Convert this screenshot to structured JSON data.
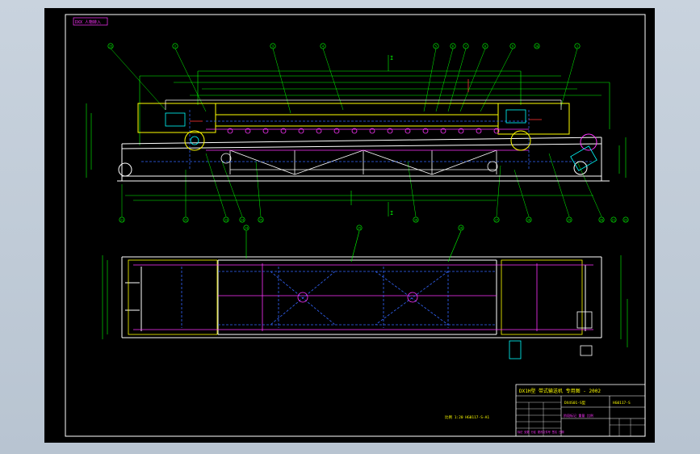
{
  "drawing": {
    "corner_tag": "DXX 人物转入",
    "title_block": {
      "main_title": "DX1H型  带式输送机 专用图 - 2002",
      "drawing_code": "DX4S01-S型",
      "sheet_code": "HG0117-S",
      "left_labels": "标记 处数 分区 更改文件号 签名 日期",
      "mid_label": "阶段标记 重量 比例"
    },
    "scale_note": "比例 1:20  HG0117-S-A1",
    "colors": {
      "background": "#000000",
      "outline": "#ffffff",
      "dimension": "#00ff00",
      "steel": "#ffff00",
      "hidden": "#3366ff",
      "center": "#ff33ff",
      "accent": "#00ffff",
      "red": "#ff3333"
    },
    "balloon_labels_top": [
      "15",
      "2",
      "3",
      "4",
      "5",
      "6",
      "7",
      "8",
      "9",
      "10",
      "1"
    ],
    "balloon_labels_bottom": [
      "11",
      "12",
      "13",
      "14",
      "15",
      "16",
      "17",
      "18",
      "19",
      "20",
      "21",
      "22"
    ],
    "balloon_labels_plan": [
      "14",
      "15",
      "16"
    ],
    "section_mark_top": "I",
    "section_mark_bottom": "I"
  }
}
